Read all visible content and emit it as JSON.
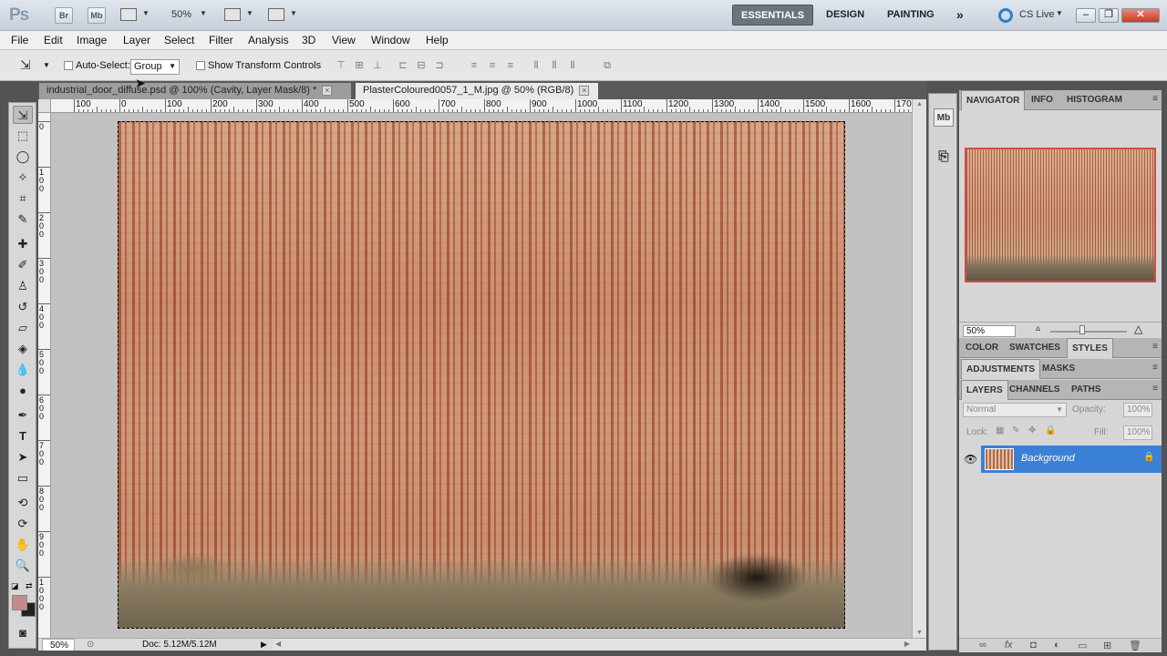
{
  "app": {
    "logo": "Ps",
    "bridge_label": "Br",
    "minibridge_label": "Mb",
    "zoom_dropdown": "50%",
    "workspaces": [
      "ESSENTIALS",
      "DESIGN",
      "PAINTING"
    ],
    "more_workspaces": "»",
    "cs_live": "CS Live",
    "window_buttons": [
      "–",
      "❐",
      "✕"
    ]
  },
  "menu": [
    "File",
    "Edit",
    "Image",
    "Layer",
    "Select",
    "Filter",
    "Analysis",
    "3D",
    "View",
    "Window",
    "Help"
  ],
  "options": {
    "auto_select_label": "Auto-Select:",
    "auto_select_value": "Group",
    "show_transform_label": "Show Transform Controls"
  },
  "tabs": [
    {
      "title": "industrial_door_diffuse.psd @ 100% (Cavity, Layer Mask/8) *",
      "close": "×"
    },
    {
      "title": "PlasterColoured0057_1_M.jpg @ 50% (RGB/8)",
      "close": "×"
    }
  ],
  "ruler": {
    "h_labels": [
      "100",
      "0",
      "100",
      "200",
      "300",
      "400",
      "500",
      "600",
      "700",
      "800",
      "900",
      "1000",
      "1100",
      "1200",
      "1300",
      "1400",
      "1500",
      "1600",
      "1700"
    ],
    "v_labels": [
      "0",
      "1 0 0",
      "2 0 0",
      "3 0 0",
      "4 0 0",
      "5 0 0",
      "6 0 0",
      "7 0 0",
      "8 0 0",
      "9 0 0",
      "1 0 0 0"
    ]
  },
  "status": {
    "zoom": "50%",
    "doc": "Doc: 5.12M/5.12M"
  },
  "panels": {
    "navigator_tabs": [
      "NAVIGATOR",
      "INFO",
      "HISTOGRAM"
    ],
    "navigator_zoom": "50%",
    "color_tabs": [
      "COLOR",
      "SWATCHES",
      "STYLES"
    ],
    "adjust_tabs": [
      "ADJUSTMENTS",
      "MASKS"
    ],
    "layer_tabs": [
      "LAYERS",
      "CHANNELS",
      "PATHS"
    ],
    "blend_mode": "Normal",
    "opacity_label": "Opacity:",
    "opacity_value": "100%",
    "lock_label": "Lock:",
    "fill_label": "Fill:",
    "fill_value": "100%",
    "layer_name": "Background",
    "menu_glyph": "≡"
  }
}
